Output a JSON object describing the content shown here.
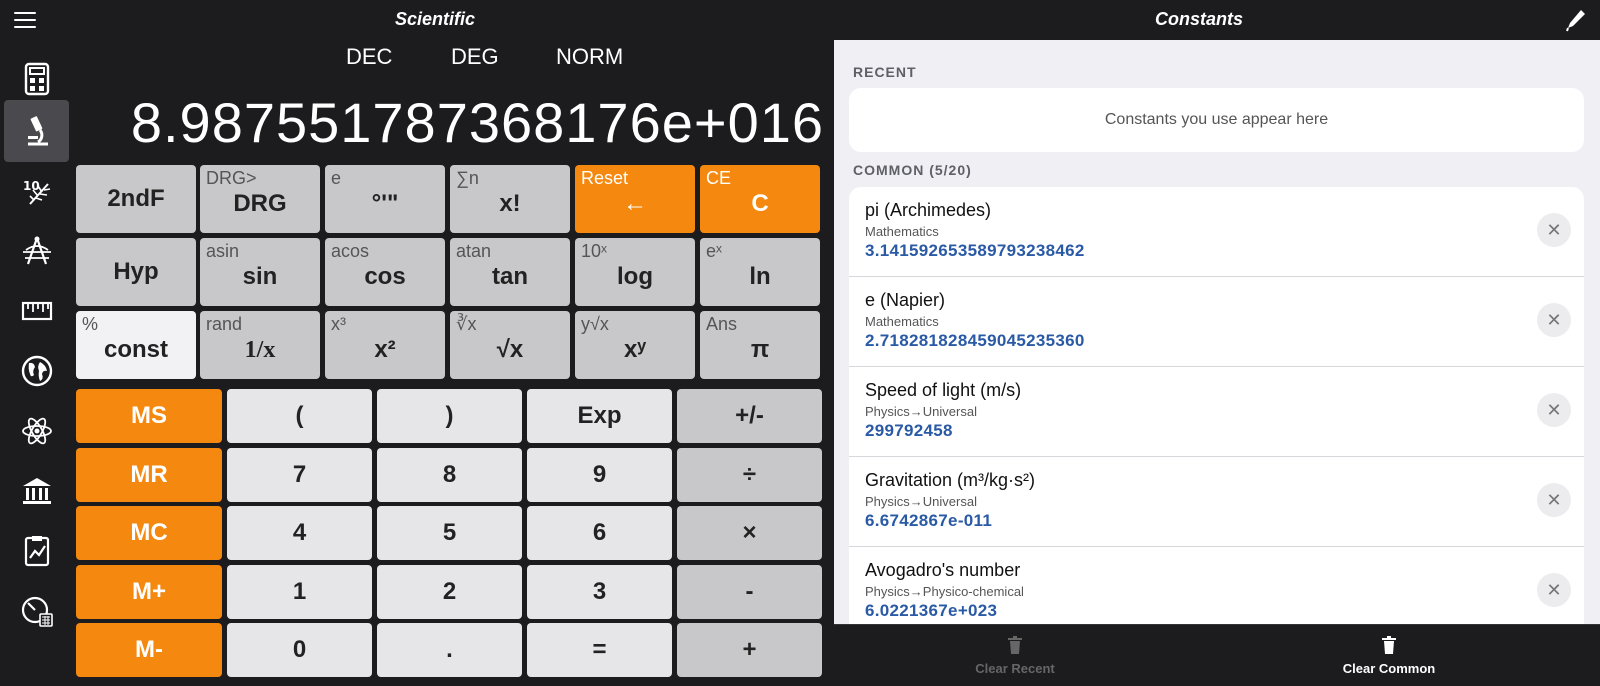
{
  "header": {
    "left_title": "Scientific",
    "right_title": "Constants"
  },
  "sidebar": {
    "items": [
      "calculator-icon",
      "microscope-icon",
      "fern-icon",
      "compass-icon",
      "ruler-icon",
      "globe-icon",
      "atom-icon",
      "bank-icon",
      "clipboard-chart-icon",
      "meter-icon"
    ],
    "active_index": 1
  },
  "modes": {
    "base": "DEC",
    "angle": "DEG",
    "notation": "NORM"
  },
  "display": {
    "value": "8.98755178736​8176e+016"
  },
  "keys": {
    "r1": [
      {
        "sub": "",
        "main": "2ndF"
      },
      {
        "sub": "DRG>",
        "main": "DRG"
      },
      {
        "sub": "e",
        "main": "°'\""
      },
      {
        "sub": "∑n",
        "main": "x!"
      },
      {
        "sub": "Reset",
        "main": "←"
      },
      {
        "sub": "CE",
        "main": "C"
      }
    ],
    "r2": [
      {
        "sub": "",
        "main": "Hyp"
      },
      {
        "sub": "asin",
        "main": "sin"
      },
      {
        "sub": "acos",
        "main": "cos"
      },
      {
        "sub": "atan",
        "main": "tan"
      },
      {
        "sub": "10ˣ",
        "main": "log"
      },
      {
        "sub": "eˣ",
        "main": "ln"
      }
    ],
    "r3": [
      {
        "sub": "%",
        "main": "const"
      },
      {
        "sub": "rand",
        "main": "1/x"
      },
      {
        "sub": "x³",
        "main": "x²"
      },
      {
        "sub": "∛x",
        "main": "√x"
      },
      {
        "sub": "y√x",
        "main": "xʸ"
      },
      {
        "sub": "Ans",
        "main": "π"
      }
    ],
    "memory": [
      "MS",
      "MR",
      "MC",
      "M+",
      "M-"
    ],
    "grid": [
      [
        "(",
        ")",
        "Exp",
        "+/-"
      ],
      [
        "7",
        "8",
        "9",
        "÷"
      ],
      [
        "4",
        "5",
        "6",
        "×"
      ],
      [
        "1",
        "2",
        "3",
        "-"
      ],
      [
        "0",
        ".",
        "=",
        "+"
      ]
    ]
  },
  "constants": {
    "recent_header": "RECENT",
    "recent_empty": "Constants you use appear here",
    "common_header": "COMMON (5/20)",
    "items": [
      {
        "name": "pi (Archimedes)",
        "category": "Mathematics",
        "value": "3.14159265358979323846​2"
      },
      {
        "name": "e (Napier)",
        "category": "Mathematics",
        "value": "2.71828182845904523536​0"
      },
      {
        "name": "Speed of light (m/s)",
        "category": "Physics→Universal",
        "value": "299792458"
      },
      {
        "name": "Gravitation (m³/kg·s²)",
        "category": "Physics→Universal",
        "value": "6.6742867e-011"
      },
      {
        "name": "Avogadro's number",
        "category": "Physics→Physico-chemical",
        "value": "6.0221367e+023"
      }
    ]
  },
  "bottom": {
    "clear_recent": "Clear Recent",
    "clear_common": "Clear Common"
  },
  "colors": {
    "orange": "#f5880f",
    "value_blue": "#2a5aa5",
    "dark_bg": "#1c1c1e"
  }
}
